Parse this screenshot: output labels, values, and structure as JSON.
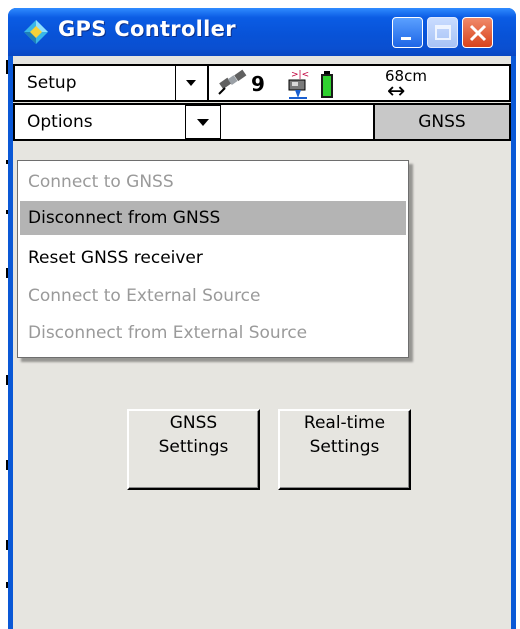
{
  "window": {
    "title": "GPS Controller"
  },
  "toolbar": {
    "setup_label": "Setup",
    "satellite_count": "9",
    "distance": "68cm",
    "distance_arrow": "↔",
    "options_label": "Options",
    "gnss_button_label": "GNSS"
  },
  "menu": {
    "items": [
      {
        "label": "Connect to GNSS",
        "enabled": false
      },
      {
        "label": "Disconnect from GNSS",
        "enabled": true,
        "highlighted": true
      },
      {
        "label": "Reset GNSS receiver",
        "enabled": true
      },
      {
        "label": "Connect to External Source",
        "enabled": false
      },
      {
        "label": "Disconnect from External Source",
        "enabled": false
      }
    ]
  },
  "buttons": {
    "gnss_settings": {
      "line1": "GNSS",
      "line2": "Settings"
    },
    "realtime_settings": {
      "line1": "Real-time",
      "line2": "Settings"
    }
  },
  "colors": {
    "titlebar": "#0a58d6",
    "client_bg": "#e6e5e0",
    "menu_highlight": "#b4b4b4",
    "disabled_text": "#9a9a9a"
  },
  "icons": [
    "app-icon",
    "minimize-icon",
    "maximize-icon",
    "close-icon",
    "satellite-icon",
    "receiver-icon",
    "battery-icon",
    "dropdown-arrow-icon"
  ]
}
